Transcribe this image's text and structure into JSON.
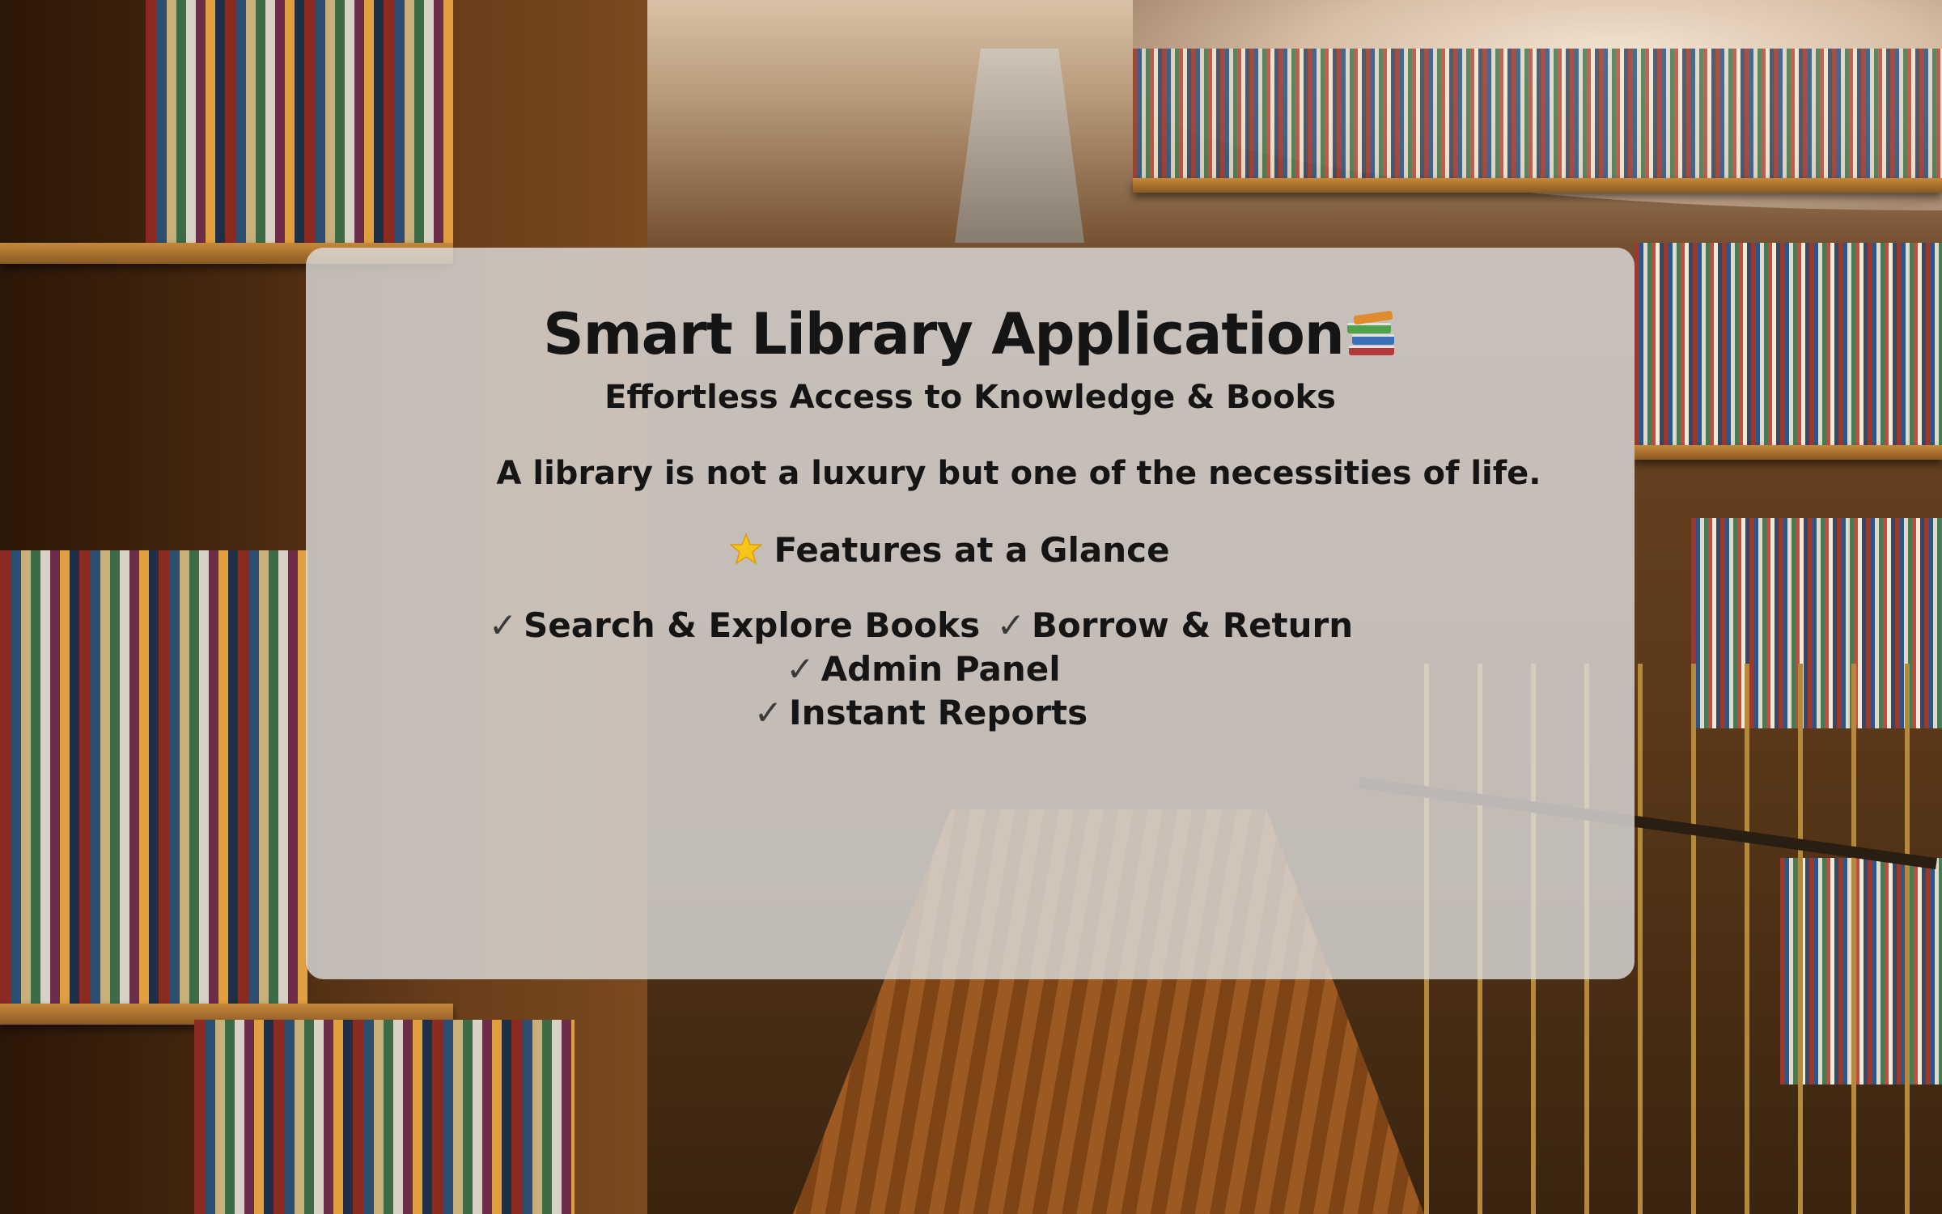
{
  "hero": {
    "title": "Smart Library Application",
    "title_icon": "books-icon",
    "subtitle": "Effortless Access to Knowledge & Books",
    "quote": "A library is not a luxury but one of the necessities of life."
  },
  "features": {
    "heading": "Features at a Glance",
    "heading_icon": "star-icon",
    "check_icon": "✓",
    "items": [
      {
        "label": "Search & Explore Books"
      },
      {
        "label": "Borrow & Return"
      },
      {
        "label": "Admin Panel"
      },
      {
        "label": "Instant Reports"
      }
    ]
  },
  "colors": {
    "card_background": "#dedede",
    "text": "#151515",
    "check": "#3a3a3a"
  }
}
